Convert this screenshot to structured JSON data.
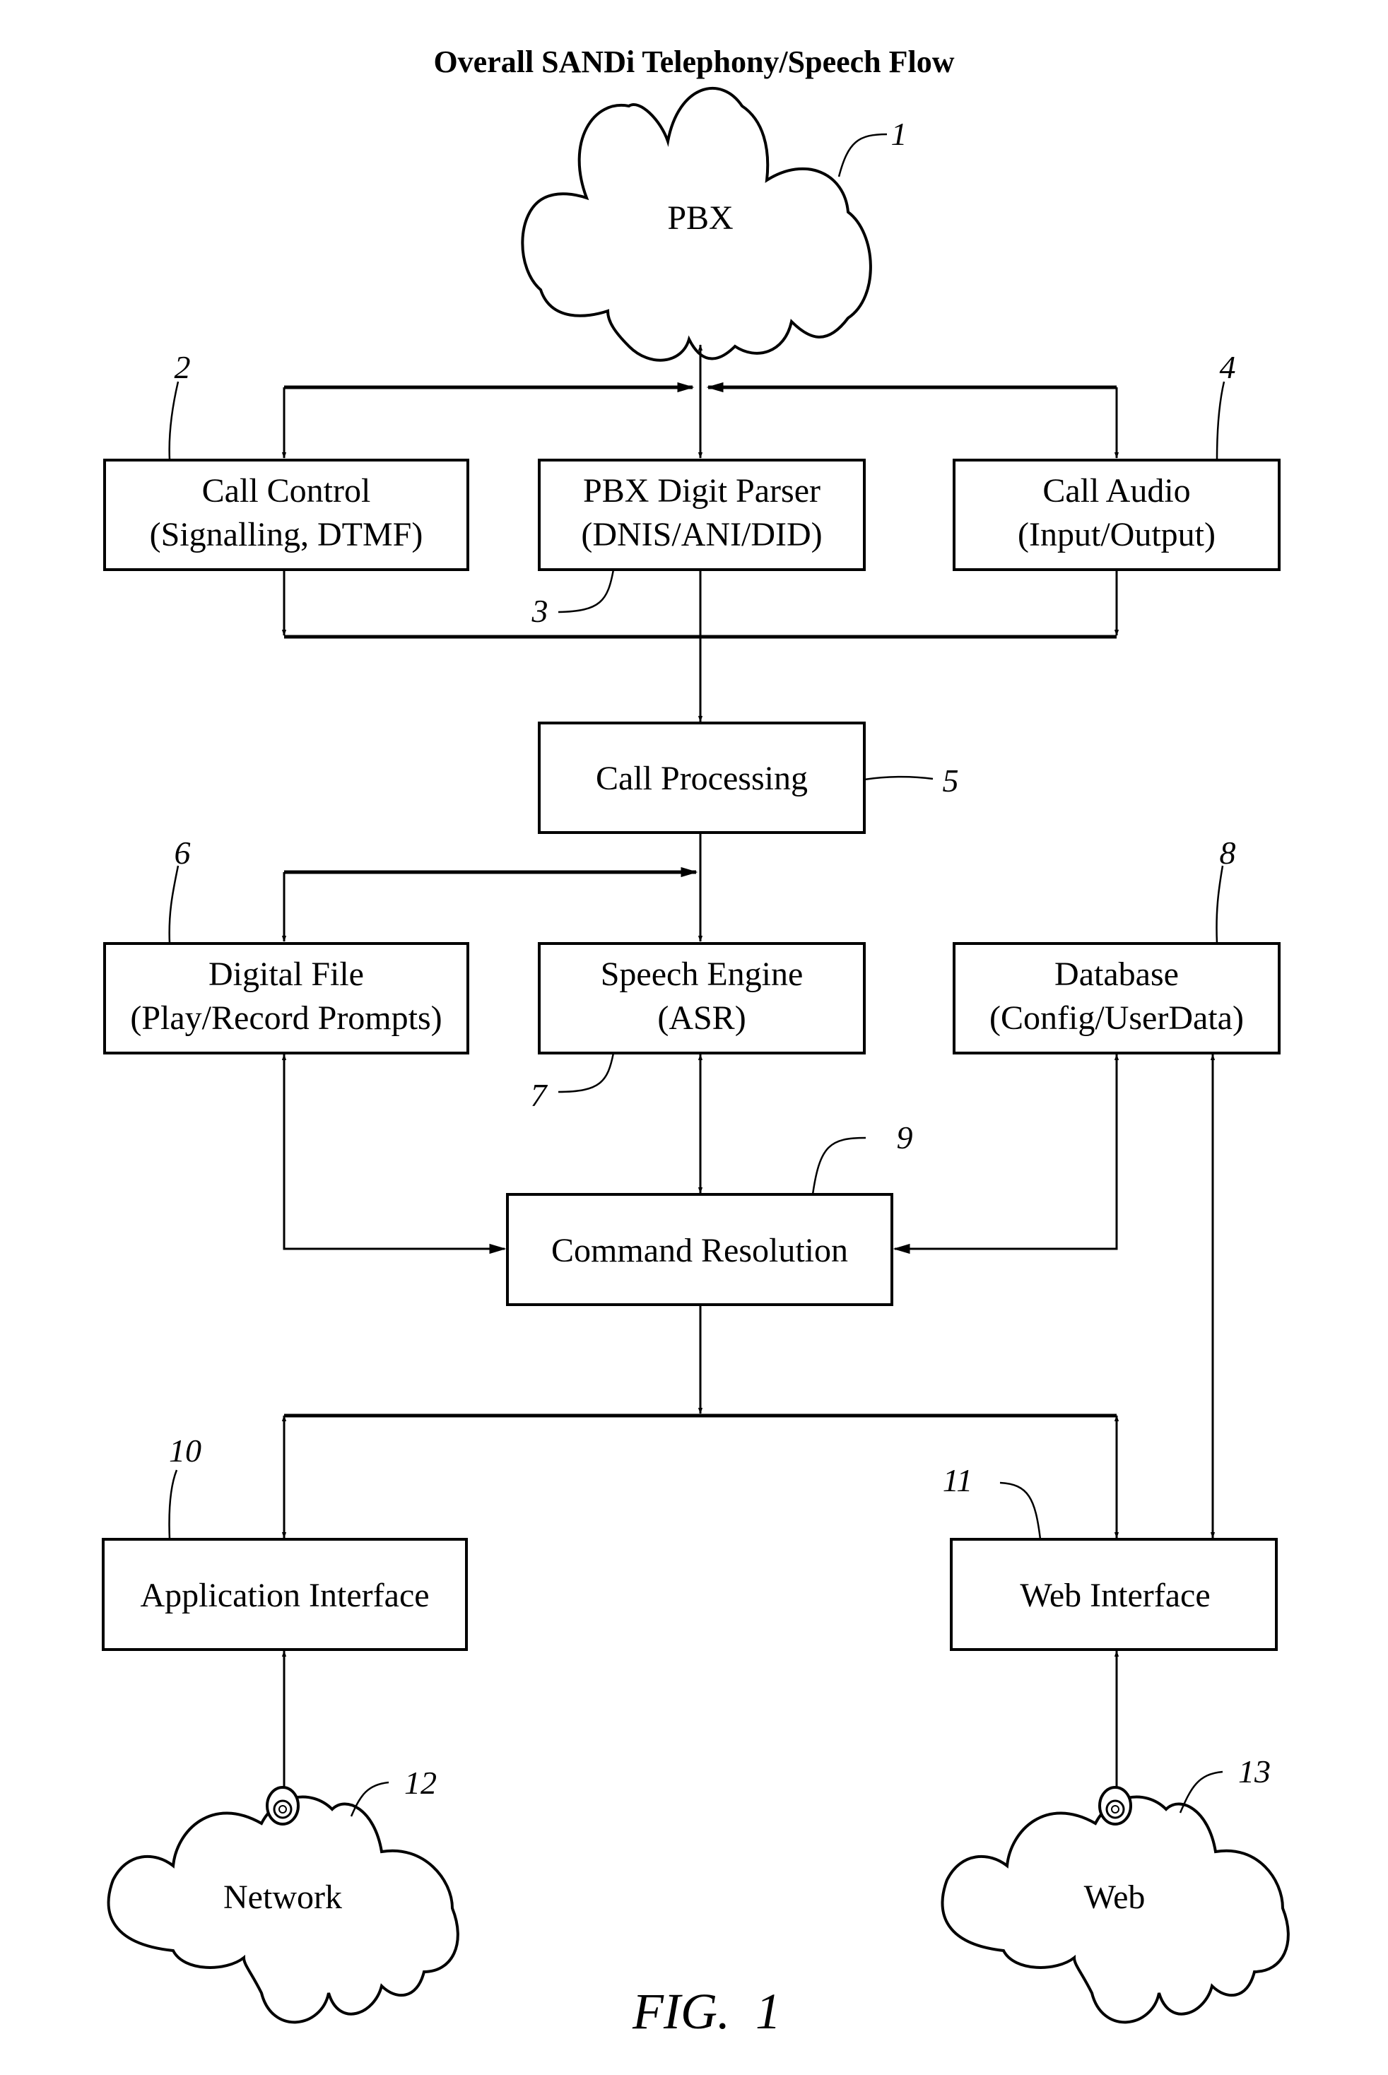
{
  "title": "Overall SANDi Telephony/Speech Flow",
  "figure_label": "FIG.  1",
  "nodes": {
    "pbx": {
      "ref": "1",
      "label": "PBX",
      "shape": "cloud"
    },
    "call_control": {
      "ref": "2",
      "line1": "Call Control",
      "line2": "(Signalling, DTMF)"
    },
    "pbx_digit_parser": {
      "ref": "3",
      "line1": "PBX Digit Parser",
      "line2": "(DNIS/ANI/DID)"
    },
    "call_audio": {
      "ref": "4",
      "line1": "Call Audio",
      "line2": "(Input/Output)"
    },
    "call_processing": {
      "ref": "5",
      "label": "Call Processing"
    },
    "digital_file": {
      "ref": "6",
      "line1": "Digital File",
      "line2": "(Play/Record Prompts)"
    },
    "speech_engine": {
      "ref": "7",
      "line1": "Speech Engine",
      "line2": "(ASR)"
    },
    "database": {
      "ref": "8",
      "line1": "Database",
      "line2": "(Config/UserData)"
    },
    "command_resolution": {
      "ref": "9",
      "label": "Command Resolution"
    },
    "application_interface": {
      "ref": "10",
      "label": "Application Interface"
    },
    "web_interface": {
      "ref": "11",
      "label": "Web Interface"
    },
    "network": {
      "ref": "12",
      "label": "Network",
      "shape": "cloud"
    },
    "web": {
      "ref": "13",
      "label": "Web",
      "shape": "cloud"
    }
  },
  "edges": [
    {
      "from": "pbx",
      "to": "call_control",
      "direction": "both"
    },
    {
      "from": "pbx",
      "to": "pbx_digit_parser",
      "direction": "both"
    },
    {
      "from": "pbx",
      "to": "call_audio",
      "direction": "both"
    },
    {
      "from": "call_control",
      "to": "call_processing",
      "direction": "forward"
    },
    {
      "from": "pbx_digit_parser",
      "to": "call_processing",
      "direction": "forward"
    },
    {
      "from": "call_audio",
      "to": "call_processing",
      "direction": "forward"
    },
    {
      "from": "call_processing",
      "to": "digital_file",
      "direction": "forward"
    },
    {
      "from": "call_processing",
      "to": "speech_engine",
      "direction": "forward"
    },
    {
      "from": "digital_file",
      "to": "command_resolution",
      "direction": "both"
    },
    {
      "from": "speech_engine",
      "to": "command_resolution",
      "direction": "both"
    },
    {
      "from": "database",
      "to": "command_resolution",
      "direction": "both"
    },
    {
      "from": "command_resolution",
      "to": "application_interface",
      "direction": "both"
    },
    {
      "from": "command_resolution",
      "to": "web_interface",
      "direction": "both"
    },
    {
      "from": "database",
      "to": "web_interface",
      "direction": "both"
    },
    {
      "from": "application_interface",
      "to": "network",
      "direction": "both"
    },
    {
      "from": "web_interface",
      "to": "web",
      "direction": "both"
    }
  ]
}
